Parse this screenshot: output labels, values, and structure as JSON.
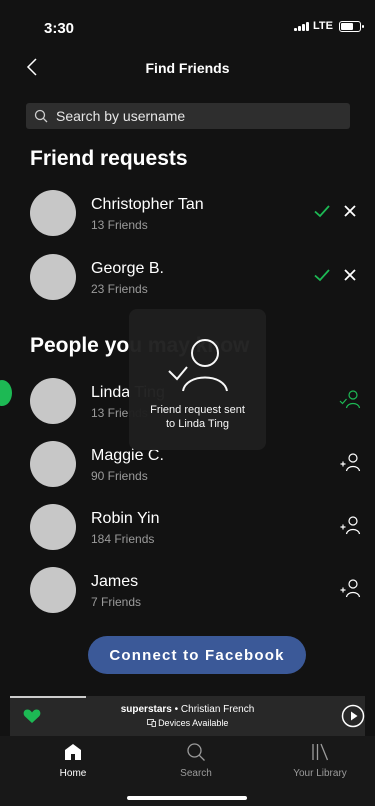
{
  "status_bar": {
    "time": "3:30",
    "network": "LTE"
  },
  "nav": {
    "title": "Find Friends"
  },
  "search": {
    "placeholder": "Search by username"
  },
  "friend_requests": {
    "title": "Friend requests",
    "items": [
      {
        "name": "Christopher Tan",
        "subtitle": "13 Friends"
      },
      {
        "name": "George B.",
        "subtitle": "23 Friends"
      }
    ]
  },
  "people_you_may_know": {
    "title": "People you may know",
    "items": [
      {
        "name": "Linda Ting",
        "subtitle": "13 Friends",
        "status": "requested"
      },
      {
        "name": "Maggie C.",
        "subtitle": "90 Friends",
        "status": "add"
      },
      {
        "name": "Robin Yin",
        "subtitle": "184 Friends",
        "status": "add"
      },
      {
        "name": "James",
        "subtitle": "7 Friends",
        "status": "add"
      }
    ]
  },
  "toast": {
    "line1": "Friend request sent",
    "line2": "to Linda Ting"
  },
  "connect_button": {
    "label": "Connect to Facebook"
  },
  "mini_player": {
    "song": "superstars",
    "separator": " • ",
    "artist": "Christian French",
    "devices": "Devices Available"
  },
  "tabbar": {
    "tabs": [
      {
        "label": "Home",
        "active": true
      },
      {
        "label": "Search",
        "active": false
      },
      {
        "label": "Your Library",
        "active": false
      }
    ]
  },
  "colors": {
    "background": "#121212",
    "accent": "#1db954",
    "facebook": "#3b5998",
    "search_bg": "#2e2e2e",
    "avatar": "#c7c7c7"
  }
}
